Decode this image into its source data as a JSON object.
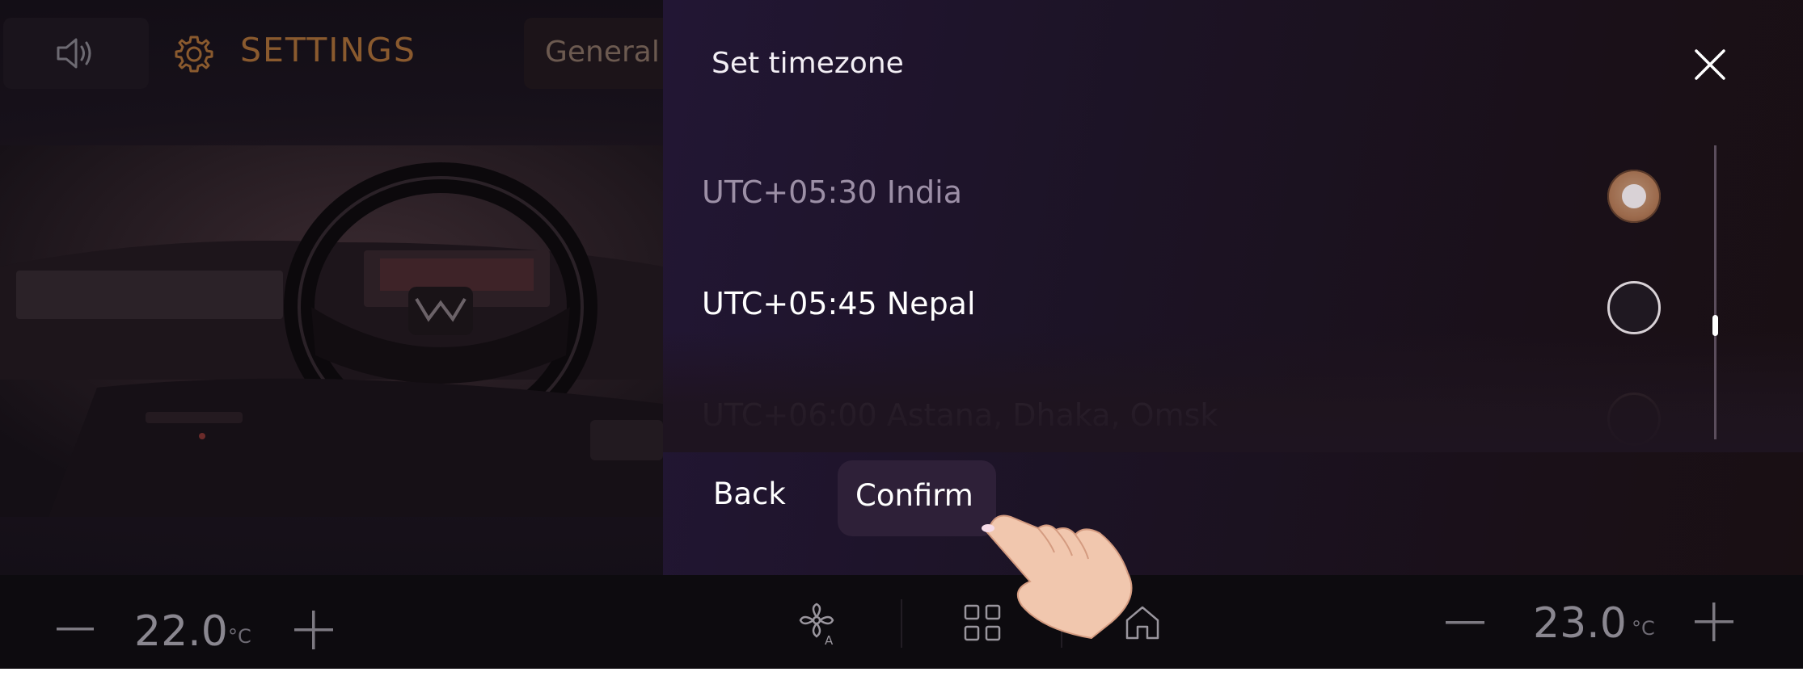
{
  "app": {
    "settings_title": "SETTINGS",
    "general_tab": "General"
  },
  "modal": {
    "title": "Set timezone",
    "options": [
      {
        "label": "UTC+05:30 India",
        "selected": true
      },
      {
        "label": "UTC+05:45 Nepal",
        "selected": false
      },
      {
        "label": "UTC+06:00 Astana, Dhaka, Omsk",
        "selected": false
      }
    ],
    "back_label": "Back",
    "confirm_label": "Confirm"
  },
  "climate": {
    "left_temp": "22.0",
    "right_temp": "23.0",
    "unit": "°C"
  },
  "icons": {
    "volume": "volume-icon",
    "settings": "gear-icon",
    "close": "close-icon",
    "fan_auto": "fan-auto-icon",
    "apps": "apps-grid-icon",
    "home": "home-icon",
    "minus": "minus-icon",
    "plus": "plus-icon"
  },
  "colors": {
    "accent_orange": "#8a5a2e",
    "selected_radio": "#9c6a4c",
    "modal_bg": "#1e1428"
  }
}
